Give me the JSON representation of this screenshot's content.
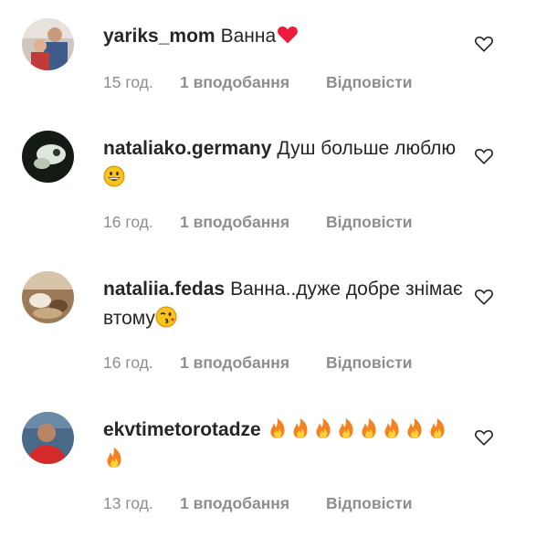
{
  "comments": [
    {
      "username": "yariks_mom",
      "text": "Ванна",
      "emojis": [
        "red-heart"
      ],
      "time": "15 год.",
      "likes": "1 вподобання",
      "reply": "Відповісти"
    },
    {
      "username": "nataliako.germany",
      "text": "Душ больше люблю",
      "emojis": [
        "grinning-face"
      ],
      "time": "16 год.",
      "likes": "1 вподобання",
      "reply": "Відповісти"
    },
    {
      "username": "nataliia.fedas",
      "text": "Ванна..дуже добре знімає втому",
      "emojis": [
        "winking-kiss-face"
      ],
      "time": "16 год.",
      "likes": "1 вподобання",
      "reply": "Відповісти"
    },
    {
      "username": "ekvtimetorotadze",
      "text": "",
      "emojis": [
        "fire",
        "fire",
        "fire",
        "fire",
        "fire",
        "fire",
        "fire",
        "fire",
        "fire"
      ],
      "time": "13 год.",
      "likes": "1 вподобання",
      "reply": "Відповісти"
    }
  ],
  "icons": {
    "like": "heart-outline-icon"
  },
  "colors": {
    "text": "#262626",
    "meta": "#8e8e8e",
    "heart_red": "#ed1c3a",
    "fire_orange": "#f58220"
  }
}
